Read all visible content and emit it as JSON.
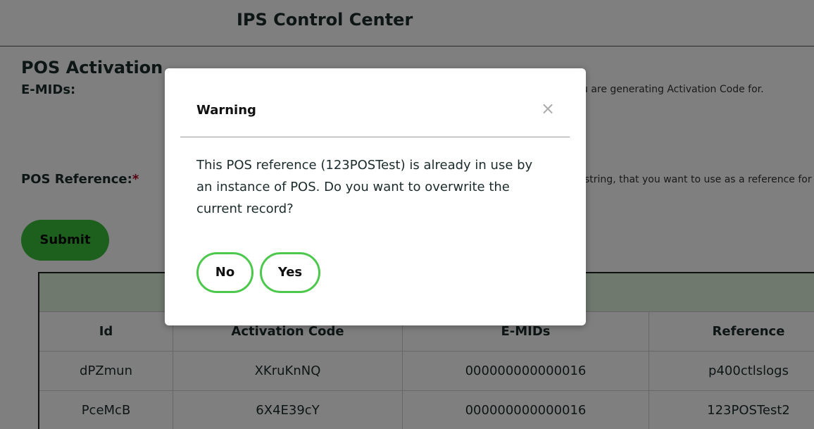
{
  "header": {
    "app_title": "IPS Control Center"
  },
  "form": {
    "section_title": "POS Activation",
    "emids_label": "E-MIDs:",
    "emids_hint": "u are generating Activation Code for.",
    "pos_reference_label": "POS Reference:",
    "required_marker": "*",
    "pos_reference_hint": "string, that you want to use as a reference for th",
    "submit_label": "Submit"
  },
  "table": {
    "columns": [
      "Id",
      "Activation Code",
      "E-MIDs",
      "Reference"
    ],
    "rows": [
      [
        "dPZmun",
        "XKruKnNQ",
        "000000000000016",
        "p400ctlslogs"
      ],
      [
        "PceMcB",
        "6X4E39cY",
        "000000000000016",
        "123POSTest2"
      ]
    ]
  },
  "modal": {
    "title": "Warning",
    "close_glyph": "×",
    "message": "This POS reference (123POSTest) is already in use by an instance of POS. Do you want to overwrite the current record?",
    "no_label": "No",
    "yes_label": "Yes"
  },
  "colors": {
    "accent_green": "#3bbf3b",
    "button_outline_green": "#4cc84c",
    "table_band": "#dff3dc",
    "required_red": "#b00020"
  }
}
